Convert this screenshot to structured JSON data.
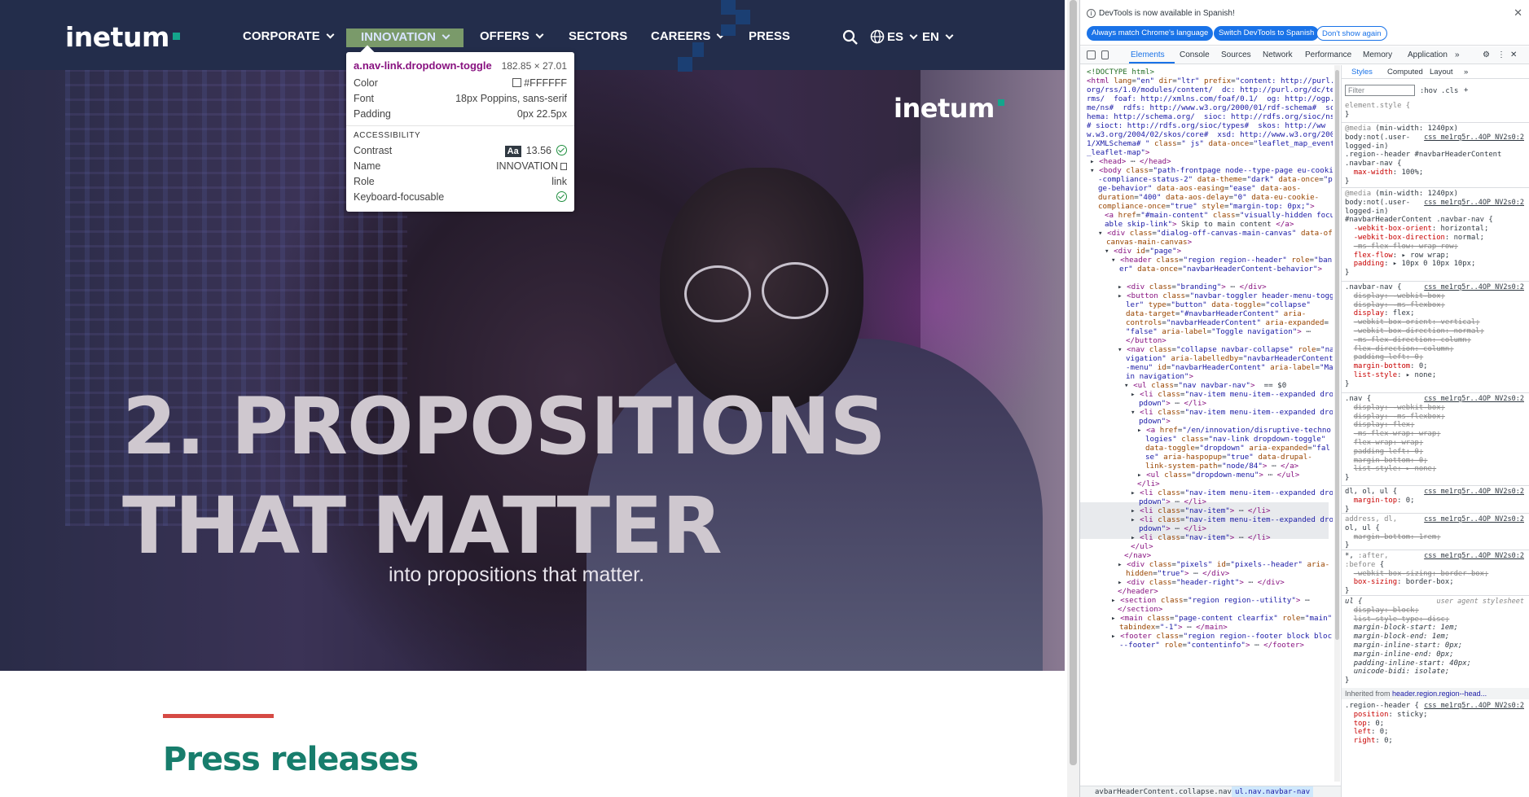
{
  "site": {
    "logo": "inetum",
    "nav": [
      {
        "label": "CORPORATE"
      },
      {
        "label": "INNOVATION"
      },
      {
        "label": "OFFERS"
      },
      {
        "label": "SECTORS"
      },
      {
        "label": "CAREERS"
      },
      {
        "label": "PRESS"
      }
    ],
    "lang_es": "ES",
    "lang_en": "EN",
    "hero": {
      "logo": "inetum",
      "title_line1": "2. PROPOSITIONS",
      "title_line2": "THAT MATTER",
      "subtitle": "into propositions that matter."
    },
    "press_title": "Press releases",
    "colors": {
      "header_bg": "#232d4b",
      "accent_teal": "#14a58c",
      "press_title": "#177d6c",
      "rule_red": "#d64a44"
    }
  },
  "tooltip": {
    "selector": "a.nav-link.dropdown-toggle",
    "dimensions": "182.85 × 27.01",
    "color_label": "Color",
    "color_value": "#FFFFFF",
    "font_label": "Font",
    "font_value": "18px Poppins, sans-serif",
    "padding_label": "Padding",
    "padding_value": "0px 22.5px",
    "accessibility_heading": "ACCESSIBILITY",
    "contrast_label": "Contrast",
    "contrast_aa": "Aa",
    "contrast_value": "13.56",
    "name_label": "Name",
    "name_value": "INNOVATION",
    "role_label": "Role",
    "role_value": "link",
    "focus_label": "Keyboard-focusable"
  },
  "devtools": {
    "info": "DevTools is now available in Spanish!",
    "btn_match": "Always match Chrome's language",
    "btn_switch": "Switch DevTools to Spanish",
    "btn_dont": "Don't show again",
    "tabs": [
      "Elements",
      "Console",
      "Sources",
      "Network",
      "Performance",
      "Memory",
      "Application"
    ],
    "style_tabs": [
      "Styles",
      "Computed",
      "Layout"
    ],
    "filter_placeholder": "Filter",
    "hov": ":hov",
    "cls": ".cls",
    "breadcrumb_a": "avbarHeaderContent.collapse.navbar-collapse",
    "breadcrumb_b": "ul.nav.navbar-nav",
    "inherited_label": "Inherited from",
    "inherited_from": "header.region.region--head..."
  }
}
